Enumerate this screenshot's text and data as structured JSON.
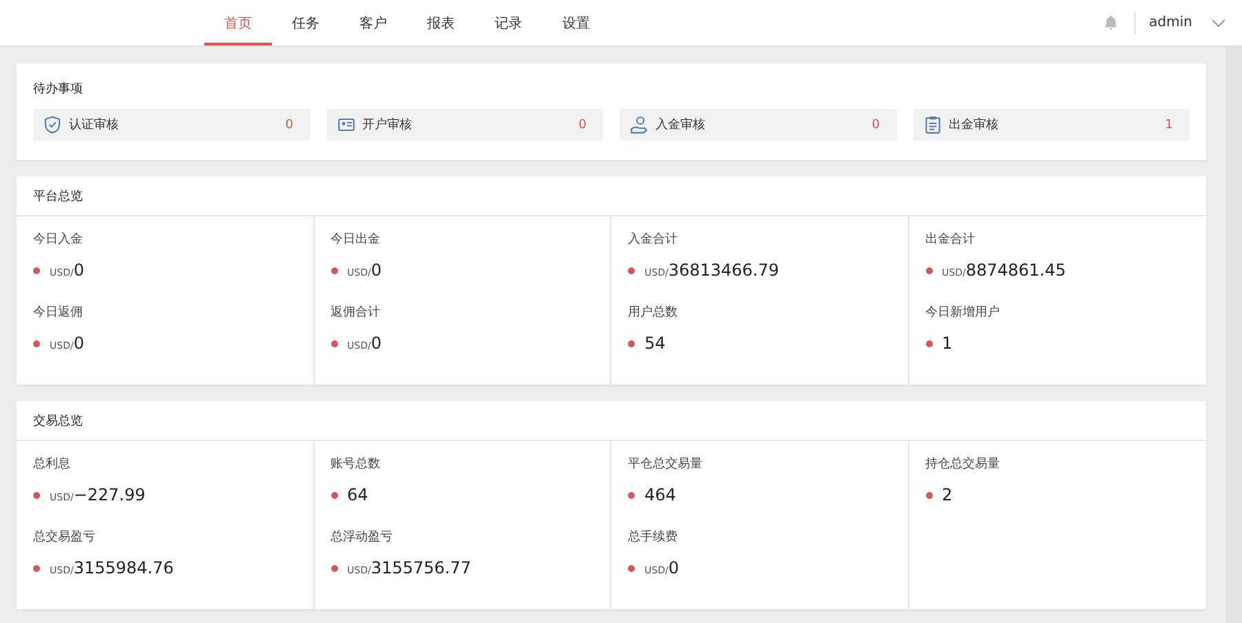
{
  "nav": {
    "tabs": [
      {
        "label": "首页",
        "selected": true
      },
      {
        "label": "任务",
        "selected": false
      },
      {
        "label": "客户",
        "selected": false
      },
      {
        "label": "报表",
        "selected": false
      },
      {
        "label": "记录",
        "selected": false
      },
      {
        "label": "设置",
        "selected": false
      }
    ],
    "user": "admin"
  },
  "todo": {
    "title": "待办事项",
    "items": [
      {
        "kind": "shield",
        "label": "认证审核",
        "count": "0"
      },
      {
        "kind": "card",
        "label": "开户审核",
        "count": "0"
      },
      {
        "kind": "hand",
        "label": "入金审核",
        "count": "0"
      },
      {
        "kind": "clipboard",
        "label": "出金审核",
        "count": "1"
      }
    ]
  },
  "sections": [
    {
      "title": "平台总览",
      "columns": [
        [
          {
            "label": "今日入金",
            "unit": "USD/",
            "value": "0"
          },
          {
            "label": "今日返佣",
            "unit": "USD/",
            "value": "0"
          }
        ],
        [
          {
            "label": "今日出金",
            "unit": "USD/",
            "value": "0"
          },
          {
            "label": "返佣合计",
            "unit": "USD/",
            "value": "0"
          }
        ],
        [
          {
            "label": "入金合计",
            "unit": "USD/",
            "value": "36813466.79"
          },
          {
            "label": "用户总数",
            "value": "54"
          }
        ],
        [
          {
            "label": "出金合计",
            "unit": "USD/",
            "value": "8874861.45"
          },
          {
            "label": "今日新增用户",
            "value": "1"
          }
        ]
      ]
    },
    {
      "title": "交易总览",
      "columns": [
        [
          {
            "label": "总利息",
            "unit": "USD/",
            "value": "−227.99"
          },
          {
            "label": "总交易盈亏",
            "unit": "USD/",
            "value": "3155984.76"
          }
        ],
        [
          {
            "label": "账号总数",
            "value": "64"
          },
          {
            "label": "总浮动盈亏",
            "unit": "USD/",
            "value": "3155756.77"
          }
        ],
        [
          {
            "label": "平仓总交易量",
            "value": "464"
          },
          {
            "label": "总手续费",
            "unit": "USD/",
            "value": "0"
          }
        ],
        [
          {
            "label": "持仓总交易量",
            "value": "2"
          }
        ]
      ]
    }
  ]
}
